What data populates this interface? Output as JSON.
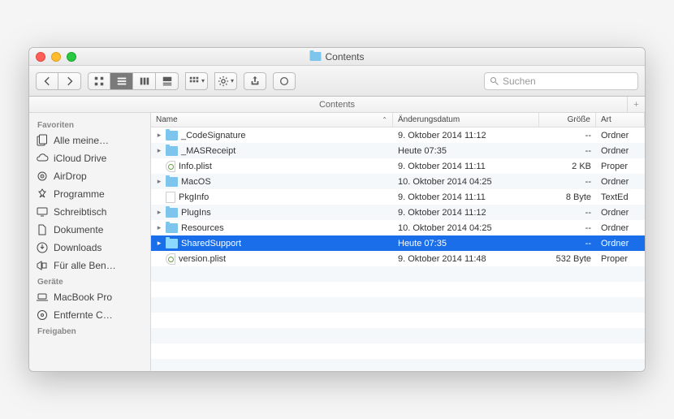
{
  "window": {
    "title": "Contents"
  },
  "toolbar": {
    "search_placeholder": "Suchen"
  },
  "pathbar": {
    "label": "Contents"
  },
  "sidebar": {
    "sections": [
      {
        "header": "Favoriten",
        "items": [
          {
            "icon": "all-files",
            "label": "Alle meine…"
          },
          {
            "icon": "icloud",
            "label": "iCloud Drive"
          },
          {
            "icon": "airdrop",
            "label": "AirDrop"
          },
          {
            "icon": "apps",
            "label": "Programme"
          },
          {
            "icon": "desktop",
            "label": "Schreibtisch"
          },
          {
            "icon": "documents",
            "label": "Dokumente"
          },
          {
            "icon": "downloads",
            "label": "Downloads"
          },
          {
            "icon": "shared",
            "label": "Für alle Ben…"
          }
        ]
      },
      {
        "header": "Geräte",
        "items": [
          {
            "icon": "laptop",
            "label": "MacBook Pro"
          },
          {
            "icon": "disk",
            "label": "Entfernte C…"
          }
        ]
      },
      {
        "header": "Freigaben",
        "items": []
      }
    ]
  },
  "columns": {
    "name": "Name",
    "date": "Änderungsdatum",
    "size": "Größe",
    "kind": "Art"
  },
  "files": [
    {
      "type": "folder",
      "name": "_CodeSignature",
      "date": "9. Oktober 2014 11:12",
      "size": "--",
      "kind": "Ordner",
      "expandable": true
    },
    {
      "type": "folder",
      "name": "_MASReceipt",
      "date": "Heute 07:35",
      "size": "--",
      "kind": "Ordner",
      "expandable": true
    },
    {
      "type": "plist",
      "name": "Info.plist",
      "date": "9. Oktober 2014 11:11",
      "size": "2 KB",
      "kind": "Proper",
      "expandable": false
    },
    {
      "type": "folder",
      "name": "MacOS",
      "date": "10. Oktober 2014 04:25",
      "size": "--",
      "kind": "Ordner",
      "expandable": true
    },
    {
      "type": "file",
      "name": "PkgInfo",
      "date": "9. Oktober 2014 11:11",
      "size": "8 Byte",
      "kind": "TextEd",
      "expandable": false
    },
    {
      "type": "folder",
      "name": "PlugIns",
      "date": "9. Oktober 2014 11:12",
      "size": "--",
      "kind": "Ordner",
      "expandable": true
    },
    {
      "type": "folder",
      "name": "Resources",
      "date": "10. Oktober 2014 04:25",
      "size": "--",
      "kind": "Ordner",
      "expandable": true
    },
    {
      "type": "folder",
      "name": "SharedSupport",
      "date": "Heute 07:35",
      "size": "--",
      "kind": "Ordner",
      "expandable": true,
      "selected": true
    },
    {
      "type": "plist",
      "name": "version.plist",
      "date": "9. Oktober 2014 11:48",
      "size": "532 Byte",
      "kind": "Proper",
      "expandable": false
    }
  ]
}
